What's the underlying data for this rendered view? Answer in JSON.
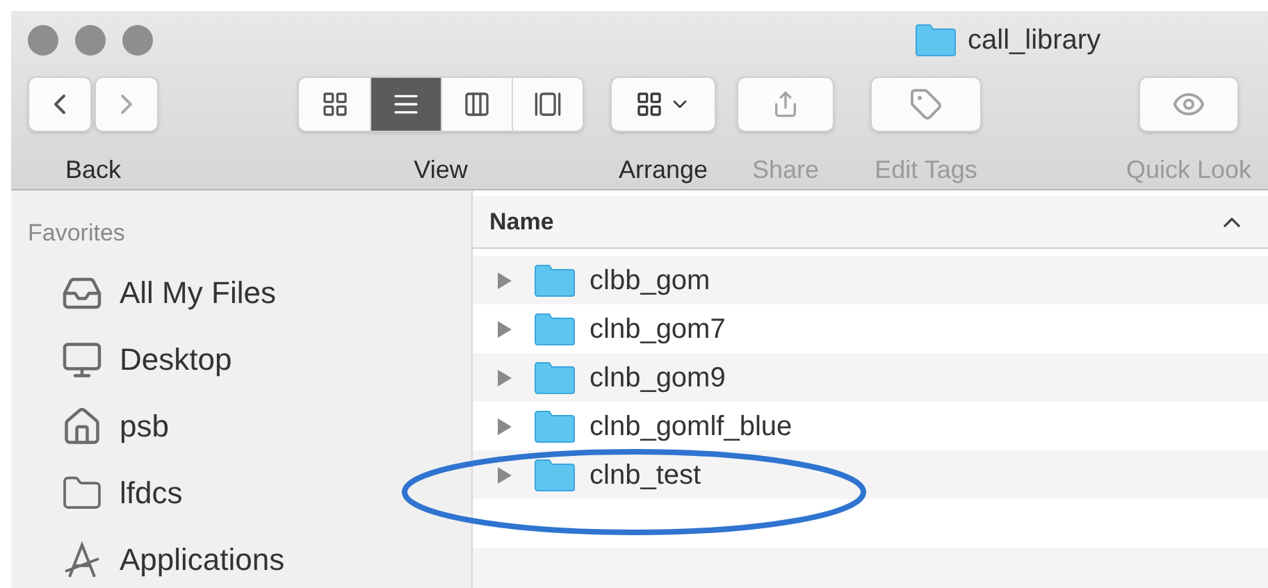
{
  "window": {
    "title": "call_library"
  },
  "toolbar": [
    {
      "kind": "nav",
      "label": "Back",
      "disabled": false
    },
    {
      "kind": "view",
      "label": "View",
      "disabled": false,
      "segments": [
        {
          "kind": "icon",
          "selected": false
        },
        {
          "kind": "list",
          "selected": true
        },
        {
          "kind": "column",
          "selected": false
        },
        {
          "kind": "gallery",
          "selected": false
        }
      ]
    },
    {
      "kind": "arrange",
      "label": "Arrange",
      "disabled": false
    },
    {
      "kind": "share",
      "label": "Share",
      "disabled": true
    },
    {
      "kind": "tags",
      "label": "Edit Tags",
      "disabled": true
    },
    {
      "kind": "quicklook",
      "label": "Quick Look",
      "disabled": true
    }
  ],
  "sidebar": {
    "heading": "Favorites",
    "items": [
      {
        "kind": "files",
        "label": "All My Files"
      },
      {
        "kind": "desktop",
        "label": "Desktop"
      },
      {
        "kind": "home",
        "label": "psb"
      },
      {
        "kind": "folder",
        "label": "lfdcs"
      },
      {
        "kind": "apps",
        "label": "Applications"
      }
    ]
  },
  "file_list": {
    "column": "Name",
    "sort_ascending": true,
    "rows": [
      {
        "name": "clbb_gom",
        "expanded": false
      },
      {
        "name": "clnb_gom7",
        "expanded": false
      },
      {
        "name": "clnb_gom9",
        "expanded": false
      },
      {
        "name": "clnb_gomlf_blue",
        "expanded": false
      },
      {
        "name": "clnb_test",
        "expanded": false
      }
    ]
  }
}
